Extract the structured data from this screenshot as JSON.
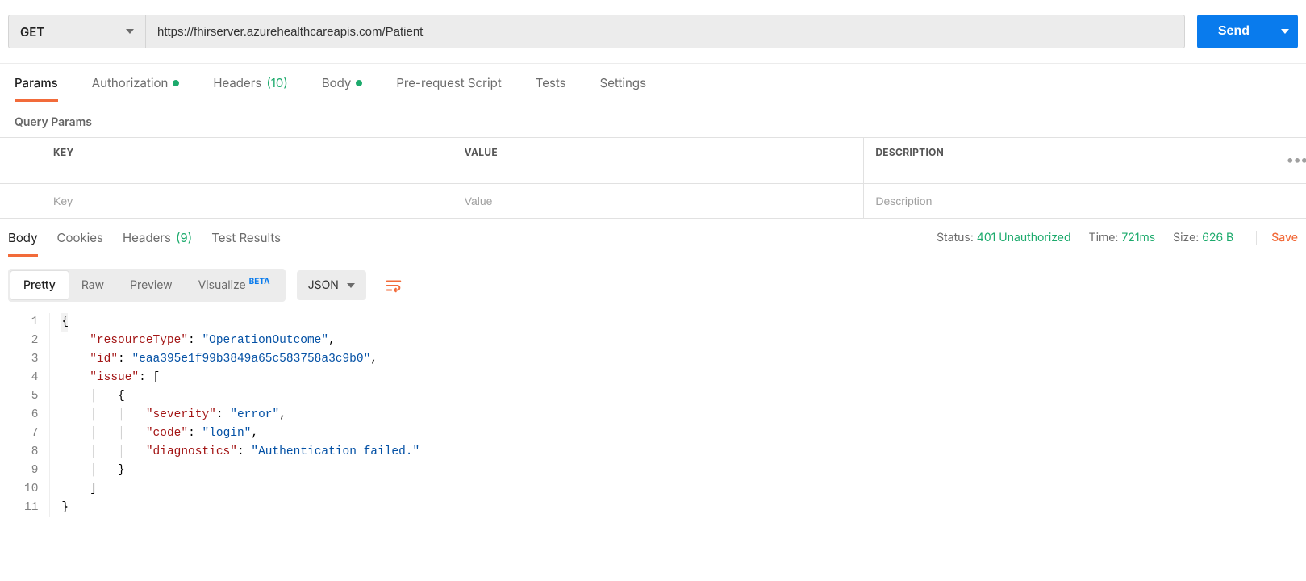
{
  "request": {
    "method": "GET",
    "url": "https://fhirserver.azurehealthcareapis.com/Patient",
    "send": "Send"
  },
  "reqTabs": {
    "params": "Params",
    "auth": "Authorization",
    "headers": "Headers",
    "headers_count": "(10)",
    "body": "Body",
    "prereq": "Pre-request Script",
    "tests": "Tests",
    "settings": "Settings"
  },
  "queryParams": {
    "title": "Query Params",
    "headers": {
      "key": "KEY",
      "value": "VALUE",
      "desc": "DESCRIPTION"
    },
    "placeholders": {
      "key": "Key",
      "value": "Value",
      "desc": "Description"
    }
  },
  "respTabs": {
    "body": "Body",
    "cookies": "Cookies",
    "headers": "Headers",
    "headers_count": "(9)",
    "tests": "Test Results"
  },
  "respMeta": {
    "status_label": "Status:",
    "status_value": "401 Unauthorized",
    "time_label": "Time:",
    "time_value": "721ms",
    "size_label": "Size:",
    "size_value": "626 B",
    "save": "Save"
  },
  "viewControls": {
    "pretty": "Pretty",
    "raw": "Raw",
    "preview": "Preview",
    "visualize": "Visualize",
    "beta": "BETA",
    "format": "JSON"
  },
  "responseBody": {
    "resourceType": "OperationOutcome",
    "id": "eaa395e1f99b3849a65c583758a3c9b0",
    "issue": [
      {
        "severity": "error",
        "code": "login",
        "diagnostics": "Authentication failed."
      }
    ]
  }
}
